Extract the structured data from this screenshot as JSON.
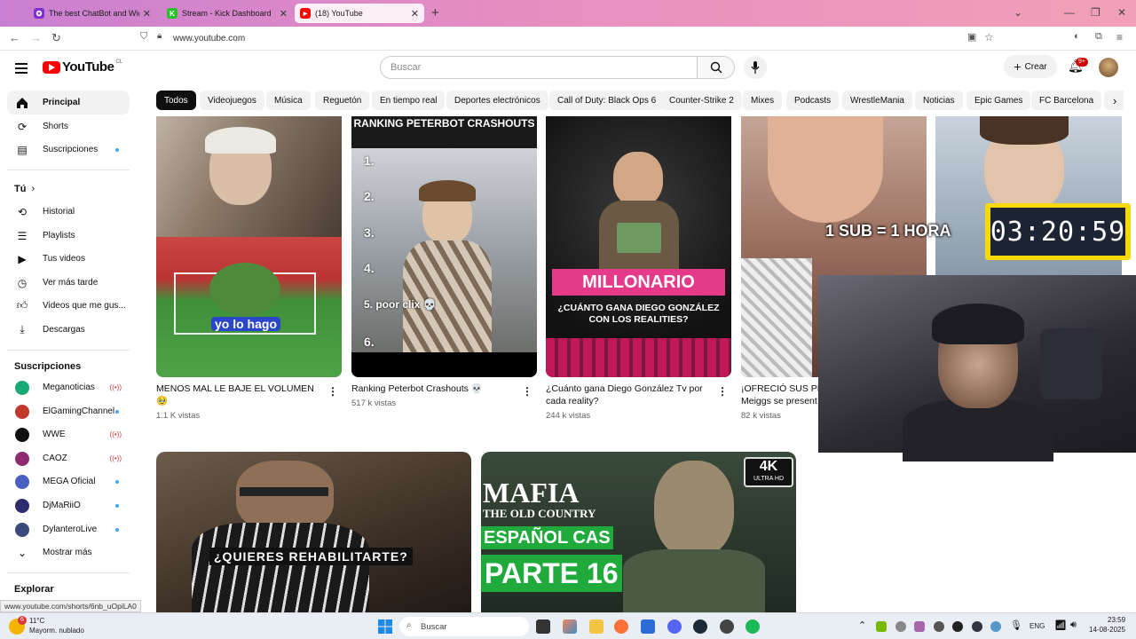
{
  "browser": {
    "tabs": [
      {
        "title": "The best ChatBot and Widgets",
        "fav_color": "#7b2fd0",
        "fav_char": "✪"
      },
      {
        "title": "Stream - Kick Dashboard",
        "fav_color": "#27c227",
        "fav_char": "K"
      },
      {
        "title": "(18) YouTube",
        "fav_color": "#ff0000",
        "fav_char": "▶"
      }
    ],
    "url": "www.youtube.com",
    "status_url": "www.youtube.com/shorts/6nb_uOpiLA0"
  },
  "header": {
    "logo_text": "YouTube",
    "country": "CL",
    "search_placeholder": "Buscar",
    "create_label": "Crear",
    "notif_count": "9+"
  },
  "sidebar": {
    "main": [
      {
        "label": "Principal",
        "icon": "home-icon"
      },
      {
        "label": "Shorts",
        "icon": "shorts-icon"
      },
      {
        "label": "Suscripciones",
        "icon": "subscriptions-icon"
      }
    ],
    "you_label": "Tú",
    "you_items": [
      {
        "label": "Historial",
        "icon": "history-icon"
      },
      {
        "label": "Playlists",
        "icon": "playlists-icon"
      },
      {
        "label": "Tus videos",
        "icon": "your-videos-icon"
      },
      {
        "label": "Ver más tarde",
        "icon": "watch-later-icon"
      },
      {
        "label": "Videos que me gus...",
        "icon": "like-icon"
      },
      {
        "label": "Descargas",
        "icon": "download-icon"
      }
    ],
    "subs_label": "Suscripciones",
    "subs": [
      {
        "label": "Meganoticias",
        "color": "#19a974",
        "status": "live"
      },
      {
        "label": "ElGamingChannel",
        "color": "#c0392b",
        "status": "dot"
      },
      {
        "label": "WWE",
        "color": "#111111",
        "status": "live"
      },
      {
        "label": "CAOZ",
        "color": "#8e2a6e",
        "status": "live"
      },
      {
        "label": "MEGA Oficial",
        "color": "#4a5fc1",
        "status": "dot"
      },
      {
        "label": "DjMaRiiO",
        "color": "#2c2c6e",
        "status": "dot"
      },
      {
        "label": "DylanteroLive",
        "color": "#3a4a7a",
        "status": "dot"
      }
    ],
    "show_more": "Mostrar más",
    "explore_label": "Explorar"
  },
  "chips": [
    "Todos",
    "Videojuegos",
    "Música",
    "Reguetón",
    "En tiempo real",
    "Deportes electrónicos",
    "Call of Duty: Black Ops 6",
    "Counter-Strike 2",
    "Mixes",
    "Podcasts",
    "WrestleMania",
    "Noticias",
    "Epic Games",
    "FC Barcelona"
  ],
  "shorts": [
    {
      "title": "MENOS MAL LE BAJE EL VOLUMEN 🥹",
      "views": "1.1 K vistas",
      "overlay": "yo lo hago"
    },
    {
      "title": "Ranking Peterbot Crashouts 💀",
      "views": "517 k vistas",
      "overlay": "RANKING PETERBOT CRASHOUTS"
    },
    {
      "title": "¿Cuánto gana Diego González Tv por cada reality?",
      "views": "244 k vistas",
      "overlay": "MILLONARIO",
      "overlay2": "¿CUÁNTO GANA DIEGO GONZÁLEZ CON LOS REALITIES?"
    },
    {
      "title": "¡OFRECIÓ SUS PRO",
      "title2": "Meiggs se present",
      "views": "82 k vistas"
    }
  ],
  "ranking_numbers": [
    "1.",
    "2.",
    "3.",
    "4.",
    "5. poor clix 💀",
    "6."
  ],
  "videos": [
    {
      "overlay": "¿QUIERES REHABILITARTE?"
    },
    {
      "overlay_l1": "MAFIA",
      "overlay_l2": "THE OLD COUNTRY",
      "overlay_l3": "ESPAÑOL CAS",
      "overlay_l4": "PARTE 16",
      "badge": "4K",
      "badge2": "Ultra HD"
    }
  ],
  "stream_overlay": {
    "sub_text": "1 SUB = 1 HORA",
    "timer": "03:20:59"
  },
  "taskbar": {
    "weather_temp": "11°C",
    "weather_desc": "Mayorm. nublado",
    "search": "Buscar",
    "lang": "ENG",
    "time": "23:59",
    "date": "14-08-2025"
  }
}
